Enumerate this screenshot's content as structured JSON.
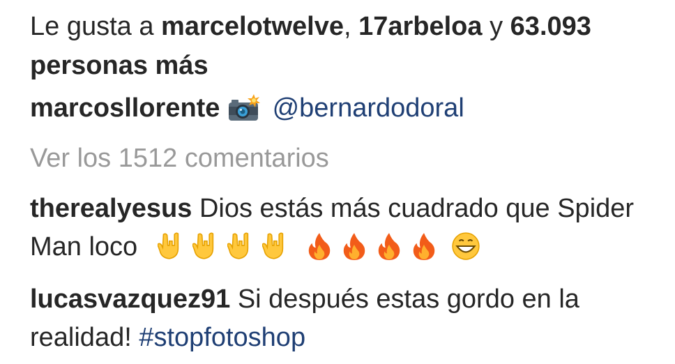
{
  "likes": {
    "prefix": "Le gusta a ",
    "user1": "marcelotwelve",
    "sep1": ", ",
    "user2": "17arbeloa",
    "sep2": " y ",
    "count": "63.093",
    "line2": "personas más"
  },
  "caption": {
    "username": "marcosllorente",
    "emoji": "camera-flash-icon",
    "mention": "@bernardodoral"
  },
  "view_comments": "Ver los 1512 comentarios",
  "comments": [
    {
      "username": "therealyesus",
      "text_line1": "Dios estás más cuadrado que Spider",
      "text_line2": "Man loco",
      "emojis": [
        "rock-hand-icon",
        "rock-hand-icon",
        "rock-hand-icon",
        "rock-hand-icon",
        "fire-icon",
        "fire-icon",
        "fire-icon",
        "fire-icon",
        "grinning-face-icon"
      ]
    },
    {
      "username": "lucasvazquez91",
      "text_line1": "Si después estas gordo en la",
      "text_line2": "realidad!",
      "hashtag": "#stopfotoshop"
    }
  ]
}
